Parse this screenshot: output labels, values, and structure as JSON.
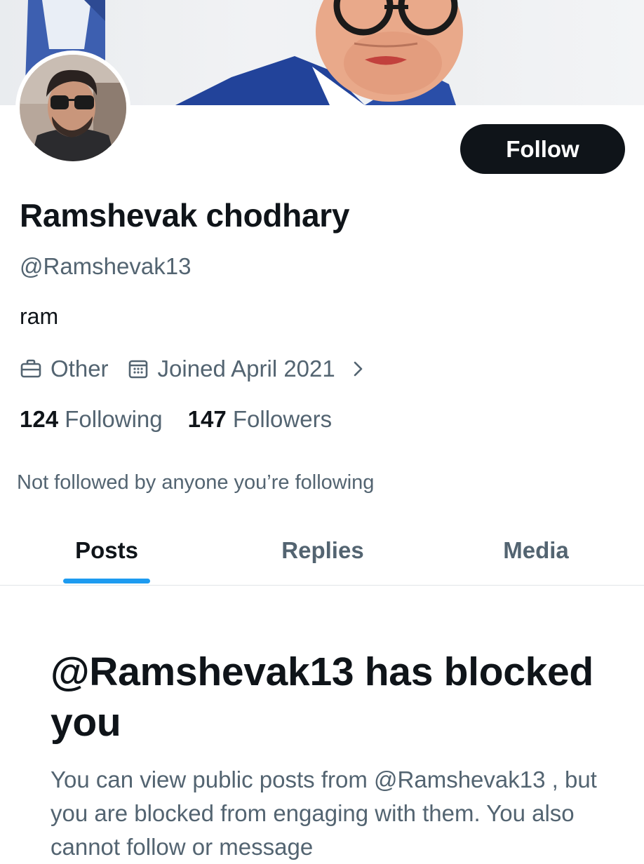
{
  "profile": {
    "display_name": "Ramshevak chodhary",
    "handle": "@Ramshevak13",
    "bio": "ram",
    "category": "Other",
    "joined": "Joined April 2021",
    "following_count": "124",
    "following_label": "Following",
    "followers_count": "147",
    "followers_label": "Followers",
    "mutuals_text": "Not followed by anyone you’re following"
  },
  "actions": {
    "follow_label": "Follow"
  },
  "tabs": [
    {
      "label": "Posts",
      "active": true
    },
    {
      "label": "Replies",
      "active": false
    },
    {
      "label": "Media",
      "active": false
    }
  ],
  "blocked": {
    "title": "@Ramshevak13 has blocked you",
    "body": "You can view public posts from @Ramshevak13 , but you are blocked from engaging with them. You also cannot follow or message"
  },
  "icons": {
    "category": "briefcase-icon",
    "joined": "calendar-icon",
    "expand": "chevron-right-icon"
  },
  "colors": {
    "text_primary": "#0f1419",
    "text_secondary": "#536471",
    "accent": "#1d9bf0",
    "button_bg": "#0f1419"
  }
}
